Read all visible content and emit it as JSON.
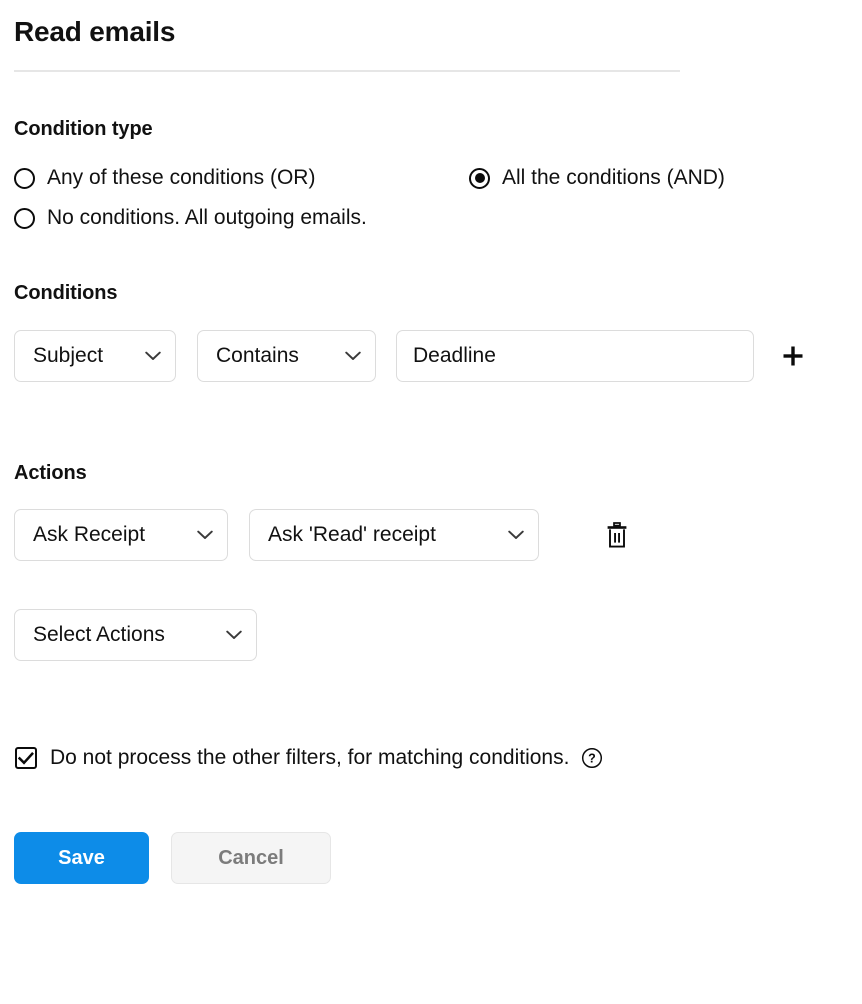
{
  "header": {
    "title": "Read emails"
  },
  "condition_type": {
    "section_label": "Condition type",
    "options": [
      {
        "label": "Any of these conditions (OR)",
        "selected": false
      },
      {
        "label": "All the conditions (AND)",
        "selected": true
      },
      {
        "label": "No conditions. All outgoing emails.",
        "selected": false
      }
    ]
  },
  "conditions": {
    "section_label": "Conditions",
    "rows": [
      {
        "field": "Subject",
        "operator": "Contains",
        "value": "Deadline",
        "value_placeholder": "Deadline"
      }
    ],
    "add_icon": "plus-icon"
  },
  "actions": {
    "section_label": "Actions",
    "rows": [
      {
        "type": "Ask Receipt",
        "value": "Ask 'Read' receipt",
        "delete_icon": "trash-icon"
      }
    ],
    "add_select_label": "Select Actions"
  },
  "options_checkbox": {
    "label": "Do not process the other filters, for matching conditions.",
    "checked": true,
    "help_icon": "question-mark-circle-icon"
  },
  "footer": {
    "save_label": "Save",
    "cancel_label": "Cancel"
  },
  "colors": {
    "primary": "#0d8ce8",
    "secondary_bg": "#f5f5f5",
    "border": "#dcdcdc",
    "text": "#111111",
    "muted_text": "#7c7c7c"
  },
  "icons": {
    "chevron_down": "chevron-down-icon"
  }
}
